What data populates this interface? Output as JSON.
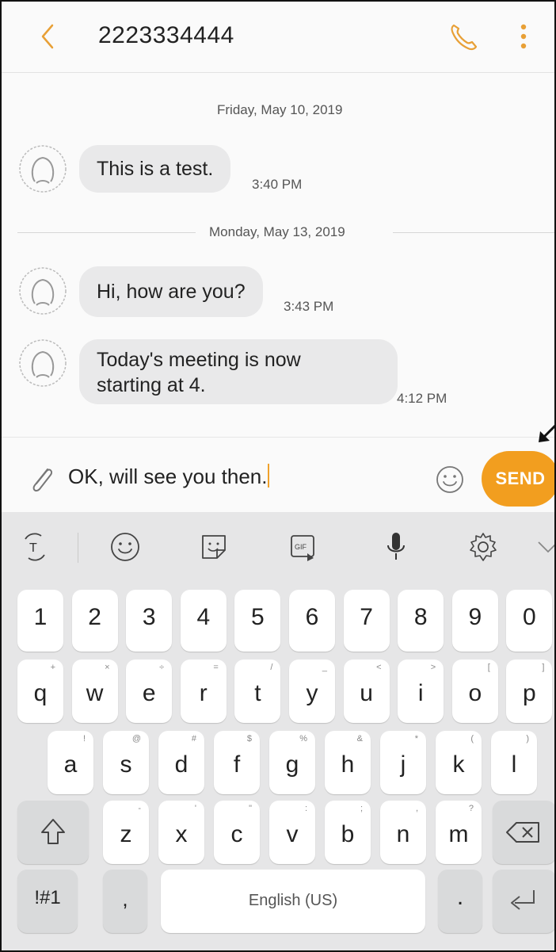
{
  "header": {
    "title": "2223334444"
  },
  "conversation": {
    "dates": [
      "Friday, May 10, 2019",
      "Monday, May 13, 2019"
    ],
    "messages": [
      {
        "text": "This is a test.",
        "time": "3:40 PM"
      },
      {
        "text": "Hi, how are you?",
        "time": "3:43 PM"
      },
      {
        "lines": [
          "Today's meeting is now",
          "starting at 4."
        ],
        "time": "4:12 PM"
      }
    ]
  },
  "composer": {
    "value": "OK, will see you then.",
    "send_label": "SEND"
  },
  "keyboard": {
    "number_row": [
      "1",
      "2",
      "3",
      "4",
      "5",
      "6",
      "7",
      "8",
      "9",
      "0"
    ],
    "row1": {
      "keys": [
        "q",
        "w",
        "e",
        "r",
        "t",
        "y",
        "u",
        "i",
        "o",
        "p"
      ],
      "hints": [
        "+",
        "×",
        "÷",
        "=",
        "/",
        "_",
        "<",
        ">",
        "[",
        "]"
      ]
    },
    "row2": {
      "keys": [
        "a",
        "s",
        "d",
        "f",
        "g",
        "h",
        "j",
        "k",
        "l"
      ],
      "hints": [
        "!",
        "@",
        "#",
        "$",
        "%",
        "&",
        "*",
        "(",
        ")"
      ]
    },
    "row3": {
      "keys": [
        "z",
        "x",
        "c",
        "v",
        "b",
        "n",
        "m"
      ],
      "hints": [
        "-",
        "'",
        "\"",
        ":",
        ";",
        ",",
        "?"
      ]
    },
    "symbols_label": "!#1",
    "comma_label": ",",
    "space_label": "English (US)",
    "period_label": "."
  },
  "colors": {
    "accent": "#f29e1f",
    "bubble": "#e9e9ea",
    "keyboard_bg": "#e6e6e7"
  }
}
